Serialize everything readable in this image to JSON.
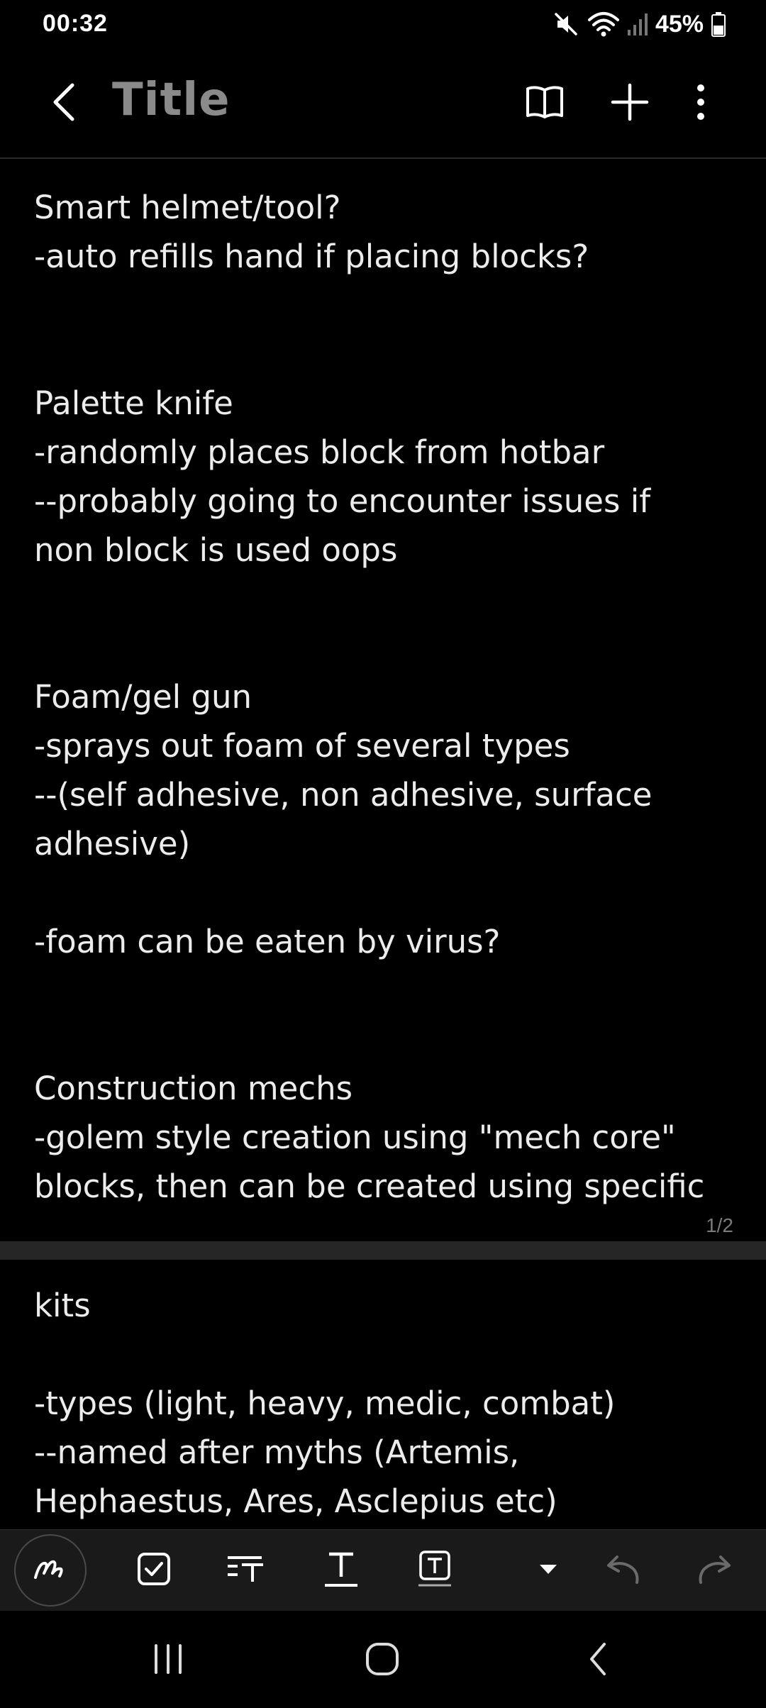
{
  "status_bar": {
    "time": "00:32",
    "battery": "45%",
    "icons": [
      "mute-icon",
      "wifi-icon",
      "signal-icon",
      "battery-icon"
    ]
  },
  "app_bar": {
    "title": "Title",
    "icons": [
      "back-arrow-icon",
      "reading-mode-icon",
      "plus-icon",
      "more-vert-icon"
    ]
  },
  "note": {
    "page1_text": "Smart helmet/tool?\n-auto refills hand if placing blocks?\n\n\nPalette knife\n-randomly places block from hotbar\n--probably going to encounter issues if\nnon block is used oops\n\n\nFoam/gel gun\n-sprays out foam of several types\n--(self adhesive, non adhesive, surface\nadhesive)\n\n-foam can be eaten by virus?\n\n\nConstruction mechs\n-golem style creation using \"mech core\"\nblocks, then can be created using specific",
    "page1_number": "1/2",
    "page2_text": "kits\n\n-types (light, heavy, medic, combat)\n--named after myths (Artemis,\nHephaestus, Ares, Asclepius etc)"
  },
  "toolbar": {
    "tools": [
      "pen-icon",
      "checkbox-icon",
      "text-style-list-icon",
      "text-format-icon",
      "text-box-icon",
      "dropdown-caret-icon",
      "undo-icon",
      "redo-icon"
    ]
  },
  "nav_bar": {
    "buttons": [
      "recents-icon",
      "home-icon",
      "back-icon"
    ]
  },
  "colors": {
    "background": "#000000",
    "text": "#ececec",
    "title": "#8a8a8a",
    "toolbar": "#1a1a1a",
    "page_gap": "#262626",
    "disabled_icon": "#6a6a6a"
  }
}
